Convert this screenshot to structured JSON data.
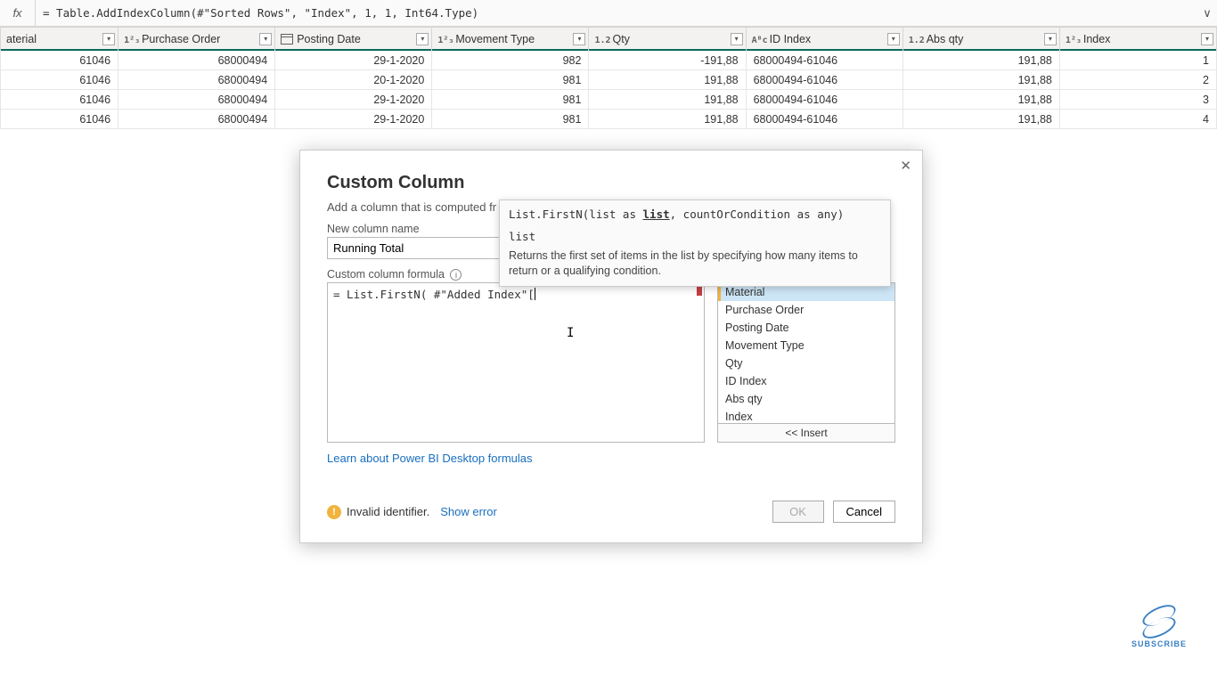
{
  "formula_bar": {
    "fx": "fx",
    "text": "= Table.AddIndexColumn(#\"Sorted Rows\", \"Index\", 1, 1, Int64.Type)"
  },
  "columns": [
    {
      "type": "",
      "label": "aterial"
    },
    {
      "type": "1²₃",
      "label": "Purchase Order"
    },
    {
      "type": "date",
      "label": "Posting Date"
    },
    {
      "type": "1²₃",
      "label": "Movement Type"
    },
    {
      "type": "1.2",
      "label": "Qty"
    },
    {
      "type": "Aᴮc",
      "label": "ID Index"
    },
    {
      "type": "1.2",
      "label": "Abs qty"
    },
    {
      "type": "1²₃",
      "label": "Index"
    }
  ],
  "rows": [
    {
      "material": "61046",
      "po": "68000494",
      "date": "29-1-2020",
      "mt": "982",
      "qty": "-191,88",
      "id": "68000494-61046",
      "abs": "191,88",
      "idx": "1"
    },
    {
      "material": "61046",
      "po": "68000494",
      "date": "20-1-2020",
      "mt": "981",
      "qty": "191,88",
      "id": "68000494-61046",
      "abs": "191,88",
      "idx": "2"
    },
    {
      "material": "61046",
      "po": "68000494",
      "date": "29-1-2020",
      "mt": "981",
      "qty": "191,88",
      "id": "68000494-61046",
      "abs": "191,88",
      "idx": "3"
    },
    {
      "material": "61046",
      "po": "68000494",
      "date": "29-1-2020",
      "mt": "981",
      "qty": "191,88",
      "id": "68000494-61046",
      "abs": "191,88",
      "idx": "4"
    }
  ],
  "dialog": {
    "title": "Custom Column",
    "subtitle": "Add a column that is computed fr",
    "new_col_label": "New column name",
    "new_col_value": "Running Total",
    "formula_label": "Custom column formula",
    "formula_value": "= List.FirstN( #\"Added Index\"[",
    "available_cols": [
      "Material",
      "Purchase Order",
      "Posting Date",
      "Movement Type",
      "Qty",
      "ID Index",
      "Abs qty",
      "Index"
    ],
    "insert_btn": "<< Insert",
    "learn_link": "Learn about Power BI Desktop formulas",
    "error_text": "Invalid identifier.",
    "show_error": "Show error",
    "ok": "OK",
    "cancel": "Cancel"
  },
  "intellisense": {
    "signature_pre": "List.FirstN(list as ",
    "signature_kw": "list",
    "signature_post": ", countOrCondition as any)",
    "param": "list",
    "desc": "Returns the first set of items in the list by specifying how many items to return or a qualifying condition."
  },
  "subscribe": "SUBSCRIBE"
}
